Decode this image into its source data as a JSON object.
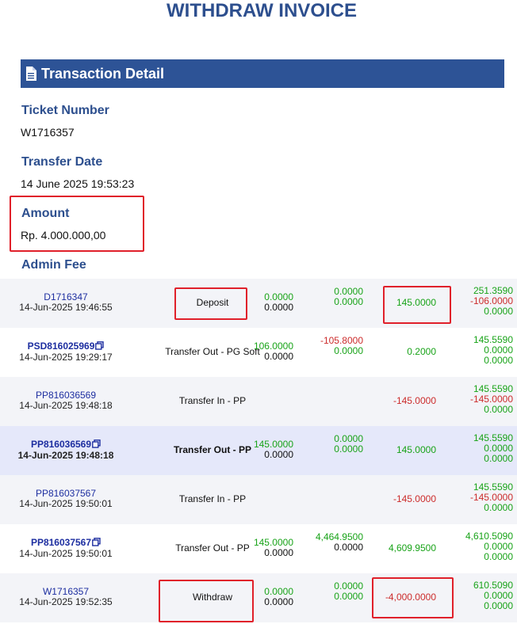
{
  "page": {
    "title": "WITHDRAW INVOICE"
  },
  "section": {
    "title": "Transaction Detail",
    "icon": "document-icon"
  },
  "fields": {
    "ticket_label": "Ticket Number",
    "ticket_value": "W1716357",
    "date_label": "Transfer Date",
    "date_value": "14 June 2025 19:53:23",
    "amount_label": "Amount",
    "amount_value": "Rp. 4.000.000,00",
    "fee_label": "Admin Fee"
  },
  "colors": {
    "header": "#2d5396",
    "accent": "#2d4f8e",
    "positive": "#18a318",
    "negative": "#cc2b2b",
    "highlight": "#e0202a"
  },
  "transactions": [
    {
      "id": "D1716347",
      "date": "14-Jun-2025 19:46:55",
      "type": "Deposit",
      "c1": [
        "0.0000",
        "0.0000"
      ],
      "c2": [
        "0.0000",
        "0.0000"
      ],
      "c3": "145.0000",
      "c4": [
        "251.3590",
        "-106.0000",
        "0.0000"
      ]
    },
    {
      "id": "PSD816025969",
      "date": "14-Jun-2025 19:29:17",
      "type": "Transfer Out - PG Soft",
      "c1": [
        "106.0000",
        "0.0000"
      ],
      "c2": [
        "-105.8000",
        "0.0000"
      ],
      "c3": "0.2000",
      "c4": [
        "145.5590",
        "0.0000",
        "0.0000"
      ]
    },
    {
      "id": "PP816036569",
      "date": "14-Jun-2025 19:48:18",
      "type": "Transfer In - PP",
      "c1": [
        "",
        ""
      ],
      "c2": [
        "",
        ""
      ],
      "c3": "-145.0000",
      "c4": [
        "145.5590",
        "-145.0000",
        "0.0000"
      ]
    },
    {
      "id": "PP816036569",
      "date": "14-Jun-2025 19:48:18",
      "type": "Transfer Out - PP",
      "c1": [
        "145.0000",
        "0.0000"
      ],
      "c2": [
        "0.0000",
        "0.0000"
      ],
      "c3": "145.0000",
      "c4": [
        "145.5590",
        "0.0000",
        "0.0000"
      ]
    },
    {
      "id": "PP816037567",
      "date": "14-Jun-2025 19:50:01",
      "type": "Transfer In - PP",
      "c1": [
        "",
        ""
      ],
      "c2": [
        "",
        ""
      ],
      "c3": "-145.0000",
      "c4": [
        "145.5590",
        "-145.0000",
        "0.0000"
      ]
    },
    {
      "id": "PP816037567",
      "date": "14-Jun-2025 19:50:01",
      "type": "Transfer Out - PP",
      "c1": [
        "145.0000",
        "0.0000"
      ],
      "c2": [
        "4,464.9500",
        "0.0000"
      ],
      "c3": "4,609.9500",
      "c4": [
        "4,610.5090",
        "0.0000",
        "0.0000"
      ]
    },
    {
      "id": "W1716357",
      "date": "14-Jun-2025 19:52:35",
      "type": "Withdraw",
      "c1": [
        "0.0000",
        "0.0000"
      ],
      "c2": [
        "0.0000",
        "0.0000"
      ],
      "c3": "-4,000.0000",
      "c4": [
        "610.5090",
        "0.0000",
        "0.0000"
      ]
    }
  ]
}
